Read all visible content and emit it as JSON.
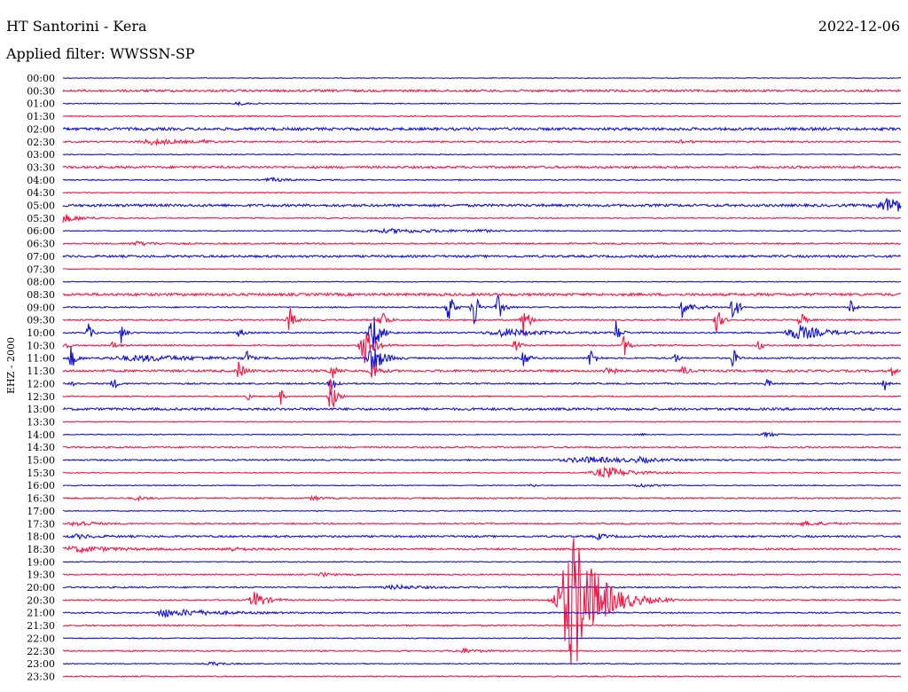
{
  "header": {
    "station": "HT Santorini - Kera",
    "date": "2022-12-06",
    "filter": "Applied filter: WWSSN-SP"
  },
  "side_label": "EHZ - 2000",
  "colors": {
    "odd": "#1010d8",
    "even": "#ff1040"
  },
  "chart_data": {
    "type": "line",
    "title": "HT Santorini - Kera",
    "subtitle": "Applied filter: WWSSN-SP",
    "ylabel": "EHZ - 2000",
    "xlabel": "",
    "rows": [
      {
        "time": "00:00",
        "noise": 0.4,
        "events": []
      },
      {
        "time": "00:30",
        "noise": 1.2,
        "events": []
      },
      {
        "time": "01:00",
        "noise": 0.5,
        "events": [
          {
            "x": 0.21,
            "amp": 2,
            "w": 0.01
          }
        ]
      },
      {
        "time": "01:30",
        "noise": 0.6,
        "events": []
      },
      {
        "time": "02:00",
        "noise": 1.5,
        "events": []
      },
      {
        "time": "02:30",
        "noise": 0.8,
        "events": [
          {
            "x": 0.11,
            "amp": 3,
            "w": 0.03
          },
          {
            "x": 0.17,
            "amp": 2,
            "w": 0.01
          },
          {
            "x": 0.74,
            "amp": 2,
            "w": 0.01
          }
        ]
      },
      {
        "time": "03:00",
        "noise": 0.5,
        "events": []
      },
      {
        "time": "03:30",
        "noise": 1.2,
        "events": []
      },
      {
        "time": "04:00",
        "noise": 0.6,
        "events": [
          {
            "x": 0.25,
            "amp": 2,
            "w": 0.02
          }
        ]
      },
      {
        "time": "04:30",
        "noise": 0.5,
        "events": []
      },
      {
        "time": "05:00",
        "noise": 1.4,
        "events": [
          {
            "x": 0.99,
            "amp": 9,
            "w": 0.03
          }
        ]
      },
      {
        "time": "05:30",
        "noise": 0.6,
        "events": [
          {
            "x": 0.0,
            "amp": 5,
            "w": 0.02
          }
        ]
      },
      {
        "time": "06:00",
        "noise": 0.5,
        "events": [
          {
            "x": 0.4,
            "amp": 2,
            "w": 0.08
          },
          {
            "x": 0.5,
            "amp": 2,
            "w": 0.01
          }
        ]
      },
      {
        "time": "06:30",
        "noise": 0.8,
        "events": [
          {
            "x": 0.09,
            "amp": 2,
            "w": 0.02
          }
        ]
      },
      {
        "time": "07:00",
        "noise": 1.2,
        "events": []
      },
      {
        "time": "07:30",
        "noise": 0.4,
        "events": []
      },
      {
        "time": "08:00",
        "noise": 0.4,
        "events": []
      },
      {
        "time": "08:30",
        "noise": 1.4,
        "events": []
      },
      {
        "time": "09:00",
        "noise": 0.7,
        "events": [
          {
            "x": 0.46,
            "amp": 22,
            "w": 0.005
          },
          {
            "x": 0.49,
            "amp": 30,
            "w": 0.005
          },
          {
            "x": 0.52,
            "amp": 14,
            "w": 0.006
          },
          {
            "x": 0.74,
            "amp": 16,
            "w": 0.004
          },
          {
            "x": 0.75,
            "amp": 3,
            "w": 0.02
          },
          {
            "x": 0.8,
            "amp": 22,
            "w": 0.005
          },
          {
            "x": 0.94,
            "amp": 20,
            "w": 0.003
          }
        ]
      },
      {
        "time": "09:30",
        "noise": 0.8,
        "events": [
          {
            "x": 0.27,
            "amp": 18,
            "w": 0.005
          },
          {
            "x": 0.38,
            "amp": 14,
            "w": 0.006
          },
          {
            "x": 0.55,
            "amp": 18,
            "w": 0.006
          },
          {
            "x": 0.78,
            "amp": 16,
            "w": 0.005
          },
          {
            "x": 0.88,
            "amp": 14,
            "w": 0.004
          }
        ]
      },
      {
        "time": "10:00",
        "noise": 0.8,
        "events": [
          {
            "x": 0.03,
            "amp": 12,
            "w": 0.004
          },
          {
            "x": 0.07,
            "amp": 12,
            "w": 0.004
          },
          {
            "x": 0.21,
            "amp": 8,
            "w": 0.004
          },
          {
            "x": 0.37,
            "amp": 24,
            "w": 0.008
          },
          {
            "x": 0.53,
            "amp": 4,
            "w": 0.04
          },
          {
            "x": 0.66,
            "amp": 14,
            "w": 0.005
          },
          {
            "x": 0.88,
            "amp": 8,
            "w": 0.03
          }
        ]
      },
      {
        "time": "10:30",
        "noise": 0.8,
        "events": [
          {
            "x": 0.0,
            "amp": 8,
            "w": 0.004
          },
          {
            "x": 0.06,
            "amp": 6,
            "w": 0.004
          },
          {
            "x": 0.36,
            "amp": 22,
            "w": 0.01
          },
          {
            "x": 0.54,
            "amp": 8,
            "w": 0.005
          },
          {
            "x": 0.67,
            "amp": 12,
            "w": 0.005
          },
          {
            "x": 0.83,
            "amp": 8,
            "w": 0.004
          }
        ]
      },
      {
        "time": "11:00",
        "noise": 0.8,
        "events": [
          {
            "x": 0.01,
            "amp": 14,
            "w": 0.005
          },
          {
            "x": 0.1,
            "amp": 3,
            "w": 0.08
          },
          {
            "x": 0.22,
            "amp": 10,
            "w": 0.004
          },
          {
            "x": 0.37,
            "amp": 18,
            "w": 0.012
          },
          {
            "x": 0.55,
            "amp": 14,
            "w": 0.005
          },
          {
            "x": 0.63,
            "amp": 12,
            "w": 0.005
          },
          {
            "x": 0.73,
            "amp": 8,
            "w": 0.004
          },
          {
            "x": 0.8,
            "amp": 12,
            "w": 0.004
          }
        ]
      },
      {
        "time": "11:30",
        "noise": 1.2,
        "events": [
          {
            "x": 0.21,
            "amp": 10,
            "w": 0.006
          },
          {
            "x": 0.32,
            "amp": 12,
            "w": 0.005
          },
          {
            "x": 0.37,
            "amp": 12,
            "w": 0.006
          },
          {
            "x": 0.65,
            "amp": 14,
            "w": 0.005
          },
          {
            "x": 0.74,
            "amp": 8,
            "w": 0.004
          },
          {
            "x": 0.99,
            "amp": 6,
            "w": 0.003
          }
        ]
      },
      {
        "time": "12:00",
        "noise": 0.8,
        "events": [
          {
            "x": 0.01,
            "amp": 6,
            "w": 0.004
          },
          {
            "x": 0.06,
            "amp": 8,
            "w": 0.004
          },
          {
            "x": 0.32,
            "amp": 14,
            "w": 0.005
          },
          {
            "x": 0.84,
            "amp": 6,
            "w": 0.004
          },
          {
            "x": 0.98,
            "amp": 10,
            "w": 0.003
          }
        ]
      },
      {
        "time": "12:30",
        "noise": 0.6,
        "events": [
          {
            "x": 0.22,
            "amp": 8,
            "w": 0.003
          },
          {
            "x": 0.26,
            "amp": 10,
            "w": 0.003
          },
          {
            "x": 0.32,
            "amp": 28,
            "w": 0.005
          }
        ]
      },
      {
        "time": "13:00",
        "noise": 1.3,
        "events": []
      },
      {
        "time": "13:30",
        "noise": 0.5,
        "events": []
      },
      {
        "time": "14:00",
        "noise": 0.5,
        "events": [
          {
            "x": 0.69,
            "amp": 1,
            "w": 0.005
          },
          {
            "x": 0.84,
            "amp": 3,
            "w": 0.01
          }
        ]
      },
      {
        "time": "14:30",
        "noise": 0.8,
        "events": []
      },
      {
        "time": "15:00",
        "noise": 0.8,
        "events": [
          {
            "x": 0.63,
            "amp": 3,
            "w": 0.06
          },
          {
            "x": 0.69,
            "amp": 3,
            "w": 0.02
          }
        ]
      },
      {
        "time": "15:30",
        "noise": 0.5,
        "events": [
          {
            "x": 0.65,
            "amp": 6,
            "w": 0.03
          }
        ]
      },
      {
        "time": "16:00",
        "noise": 0.5,
        "events": [
          {
            "x": 0.56,
            "amp": 2,
            "w": 0.005
          },
          {
            "x": 0.69,
            "amp": 2,
            "w": 0.015
          }
        ]
      },
      {
        "time": "16:30",
        "noise": 0.8,
        "events": [
          {
            "x": 0.09,
            "amp": 2,
            "w": 0.01
          },
          {
            "x": 0.3,
            "amp": 2,
            "w": 0.01
          }
        ]
      },
      {
        "time": "17:00",
        "noise": 0.5,
        "events": []
      },
      {
        "time": "17:30",
        "noise": 0.7,
        "events": [
          {
            "x": 0.02,
            "amp": 3,
            "w": 0.02
          },
          {
            "x": 0.89,
            "amp": 2,
            "w": 0.03
          }
        ]
      },
      {
        "time": "18:00",
        "noise": 1.0,
        "events": [
          {
            "x": 0.02,
            "amp": 2,
            "w": 0.02
          },
          {
            "x": 0.64,
            "amp": 3,
            "w": 0.01
          }
        ]
      },
      {
        "time": "18:30",
        "noise": 1.0,
        "events": [
          {
            "x": 0.02,
            "amp": 3,
            "w": 0.04
          },
          {
            "x": 0.2,
            "amp": 2,
            "w": 0.02
          }
        ]
      },
      {
        "time": "19:00",
        "noise": 0.5,
        "events": []
      },
      {
        "time": "19:30",
        "noise": 0.7,
        "events": [
          {
            "x": 0.31,
            "amp": 2,
            "w": 0.01
          }
        ]
      },
      {
        "time": "20:00",
        "noise": 0.8,
        "events": [
          {
            "x": 0.4,
            "amp": 2,
            "w": 0.03
          }
        ]
      },
      {
        "time": "20:30",
        "noise": 0.7,
        "events": [
          {
            "x": 0.23,
            "amp": 10,
            "w": 0.012
          },
          {
            "x": 0.61,
            "amp": 80,
            "w": 0.03
          }
        ]
      },
      {
        "time": "21:00",
        "noise": 0.7,
        "events": [
          {
            "x": 0.12,
            "amp": 6,
            "w": 0.012
          },
          {
            "x": 0.15,
            "amp": 3,
            "w": 0.05
          }
        ]
      },
      {
        "time": "21:30",
        "noise": 0.8,
        "events": []
      },
      {
        "time": "22:00",
        "noise": 0.5,
        "events": []
      },
      {
        "time": "22:30",
        "noise": 0.7,
        "events": [
          {
            "x": 0.48,
            "amp": 2,
            "w": 0.02
          }
        ]
      },
      {
        "time": "23:00",
        "noise": 0.5,
        "events": [
          {
            "x": 0.18,
            "amp": 2,
            "w": 0.015
          }
        ]
      },
      {
        "time": "23:30",
        "noise": 0.6,
        "events": []
      }
    ]
  }
}
